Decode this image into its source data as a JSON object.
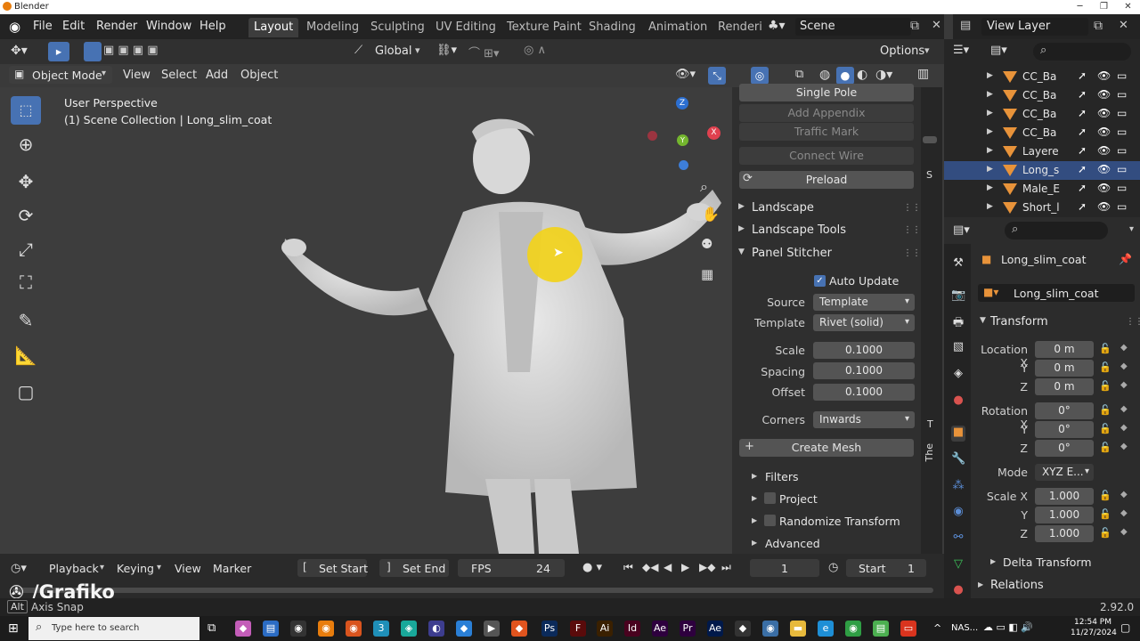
{
  "window": {
    "title": "Blender"
  },
  "menubar": {
    "items": [
      "File",
      "Edit",
      "Render",
      "Window",
      "Help"
    ],
    "workspaces": [
      "Layout",
      "Modeling",
      "Sculpting",
      "UV Editing",
      "Texture Paint",
      "Shading",
      "Animation",
      "Renderi"
    ],
    "scene": "Scene",
    "view_layer": "View Layer"
  },
  "toolbar": {
    "orientation": "Global",
    "options": "Options"
  },
  "viewport_header": {
    "mode": "Object Mode",
    "menus": [
      "View",
      "Select",
      "Add",
      "Object"
    ]
  },
  "viewport": {
    "perspective": "User Perspective",
    "collection": "(1) Scene Collection | Long_slim_coat"
  },
  "gizmo": {
    "z": "Z",
    "y": "Y",
    "x": "X"
  },
  "npanel": {
    "single_pole": "Single Pole",
    "add_appendix": "Add Appendix",
    "traffic_mark": "Traffic Mark",
    "connect_wire": "Connect Wire",
    "preload": "Preload",
    "landscape": "Landscape",
    "landscape_tools": "Landscape Tools",
    "panel_stitcher": "Panel Stitcher",
    "auto_update": "Auto Update",
    "source_label": "Source",
    "source_value": "Template",
    "template_label": "Template",
    "template_value": "Rivet (solid)",
    "scale_label": "Scale",
    "scale_value": "0.1000",
    "spacing_label": "Spacing",
    "spacing_value": "0.1000",
    "offset_label": "Offset",
    "offset_value": "0.1000",
    "corners_label": "Corners",
    "corners_value": "Inwards",
    "create_mesh": "Create Mesh",
    "filters": "Filters",
    "project": "Project",
    "randomize": "Randomize Transform",
    "advanced": "Advanced"
  },
  "ntabs": [
    "S",
    "T",
    "The"
  ],
  "outliner": {
    "rows": [
      {
        "name": "CC_Ba",
        "selected": false
      },
      {
        "name": "CC_Ba",
        "selected": false
      },
      {
        "name": "CC_Ba",
        "selected": false
      },
      {
        "name": "CC_Ba",
        "selected": false
      },
      {
        "name": "Layere",
        "selected": false
      },
      {
        "name": "Long_s",
        "selected": true
      },
      {
        "name": "Male_E",
        "selected": false
      },
      {
        "name": "Short_l",
        "selected": false
      }
    ]
  },
  "properties": {
    "object_name": "Long_slim_coat",
    "data_name": "Long_slim_coat",
    "transform": "Transform",
    "location_x_label": "Location X",
    "location_x": "0 m",
    "y_label": "Y",
    "z_label": "Z",
    "location_y": "0 m",
    "location_z": "0 m",
    "rotation_x_label": "Rotation X",
    "rotation_x": "0°",
    "rotation_y": "0°",
    "rotation_z": "0°",
    "mode_label": "Mode",
    "mode": "XYZ E...",
    "scale_x_label": "Scale X",
    "scale_x": "1.000",
    "scale_y": "1.000",
    "scale_z": "1.000",
    "delta_transform": "Delta Transform",
    "relations": "Relations"
  },
  "timeline": {
    "playback": "Playback",
    "keying": "Keying",
    "view": "View",
    "marker": "Marker",
    "set_start": "Set Start",
    "set_end": "Set End",
    "fps_label": "FPS",
    "fps": "24",
    "current_frame": "1",
    "start_label": "Start",
    "start": "1"
  },
  "statusbar": {
    "watermark": "/Grafiko",
    "key": "Alt",
    "hint": "Axis Snap",
    "version": "2.92.0"
  },
  "taskbar": {
    "search": "Type here to search",
    "network": "NAS...",
    "time": "12:54 PM",
    "date": "11/27/2024"
  },
  "colors": {
    "accent": "#4772b3",
    "object": "#e8933a",
    "cursor_highlight": "#f2d21b"
  }
}
